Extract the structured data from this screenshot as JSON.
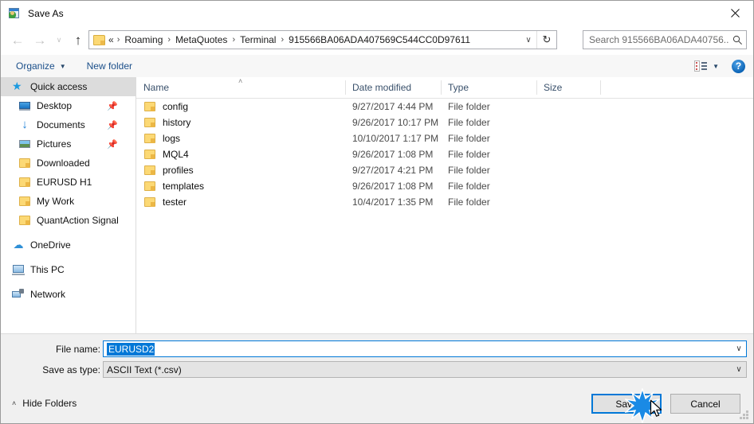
{
  "window": {
    "title": "Save As",
    "icon": "save-as-icon",
    "close_label": "✕"
  },
  "navigation": {
    "back_icon": "back-arrow-icon",
    "forward_icon": "forward-arrow-icon",
    "recent_icon": "chevron-down-icon",
    "up_icon": "up-arrow-icon",
    "back_glyph": "←",
    "forward_glyph": "→",
    "up_glyph": "↑",
    "recent_glyph": "∨"
  },
  "address": {
    "folder_icon": "folder-icon",
    "overflow": "«",
    "separator": "›",
    "crumbs": [
      "Roaming",
      "MetaQuotes",
      "Terminal",
      "915566BA06ADA407569C544CC0D97611"
    ],
    "dropdown_glyph": "∨",
    "refresh_glyph": "↻"
  },
  "search": {
    "placeholder": "Search 915566BA06ADA40756...",
    "icon": "search-icon",
    "value": ""
  },
  "toolbar": {
    "organize_label": "Organize",
    "organize_caret": "▼",
    "new_folder_label": "New folder",
    "view_icon": "view-options-icon",
    "view_caret": "▼",
    "help_icon": "help-icon",
    "help_glyph": "?"
  },
  "sidebar": {
    "items": [
      {
        "label": "Quick access",
        "icon": "star-icon",
        "level": "root",
        "selected": true,
        "pinned": false
      },
      {
        "label": "Desktop",
        "icon": "monitor-icon",
        "level": "lvl0",
        "selected": false,
        "pinned": true
      },
      {
        "label": "Documents",
        "icon": "download-icon",
        "level": "lvl0",
        "selected": false,
        "pinned": true
      },
      {
        "label": "Pictures",
        "icon": "pictures-icon",
        "level": "lvl0",
        "selected": false,
        "pinned": true
      },
      {
        "label": "Downloaded",
        "icon": "folder-icon",
        "level": "lvl0",
        "selected": false,
        "pinned": false
      },
      {
        "label": "EURUSD H1",
        "icon": "folder-icon",
        "level": "lvl0",
        "selected": false,
        "pinned": false
      },
      {
        "label": "My Work",
        "icon": "folder-icon",
        "level": "lvl0",
        "selected": false,
        "pinned": false
      },
      {
        "label": "QuantAction Signal",
        "icon": "folder-icon",
        "level": "lvl0",
        "selected": false,
        "pinned": false
      },
      {
        "label": "OneDrive",
        "icon": "cloud-icon",
        "level": "root",
        "selected": false,
        "pinned": false,
        "gap_before": true
      },
      {
        "label": "This PC",
        "icon": "pc-icon",
        "level": "root",
        "selected": false,
        "pinned": false,
        "gap_before": true
      },
      {
        "label": "Network",
        "icon": "network-icon",
        "level": "root",
        "selected": false,
        "pinned": false,
        "gap_before": true
      }
    ],
    "pin_glyph": "📌"
  },
  "file_list": {
    "columns": [
      {
        "label": "Name",
        "sorted": true,
        "sort_glyph": "˄"
      },
      {
        "label": "Date modified",
        "sorted": false,
        "sort_glyph": ""
      },
      {
        "label": "Type",
        "sorted": false,
        "sort_glyph": ""
      },
      {
        "label": "Size",
        "sorted": false,
        "sort_glyph": ""
      }
    ],
    "rows": [
      {
        "name": "config",
        "icon": "folder-icon",
        "date": "9/27/2017 4:44 PM",
        "type": "File folder",
        "size": ""
      },
      {
        "name": "history",
        "icon": "folder-icon",
        "date": "9/26/2017 10:17 PM",
        "type": "File folder",
        "size": ""
      },
      {
        "name": "logs",
        "icon": "folder-icon",
        "date": "10/10/2017 1:17 PM",
        "type": "File folder",
        "size": ""
      },
      {
        "name": "MQL4",
        "icon": "folder-icon",
        "date": "9/26/2017 1:08 PM",
        "type": "File folder",
        "size": ""
      },
      {
        "name": "profiles",
        "icon": "folder-icon",
        "date": "9/27/2017 4:21 PM",
        "type": "File folder",
        "size": ""
      },
      {
        "name": "templates",
        "icon": "folder-icon",
        "date": "9/26/2017 1:08 PM",
        "type": "File folder",
        "size": ""
      },
      {
        "name": "tester",
        "icon": "folder-icon",
        "date": "10/4/2017 1:35 PM",
        "type": "File folder",
        "size": ""
      }
    ]
  },
  "form": {
    "file_name_label": "File name:",
    "file_name_value": "EURUSD2",
    "file_name_selected": true,
    "save_type_label": "Save as type:",
    "save_type_value": "ASCII Text (*.csv)",
    "caret_glyph": "∨"
  },
  "footer": {
    "hide_folders_label": "Hide Folders",
    "hide_folders_caret": "˄",
    "save_label": "Save",
    "cancel_label": "Cancel",
    "save_focused": true,
    "resize_grip": "resize-grip"
  },
  "colors": {
    "accent": "#0078d7",
    "selection": "#0078d7",
    "sidebar_selection": "#dcdcdc",
    "link": "#1b4f8a",
    "folder": "#fcd975",
    "window_bg": "#f0f0f0",
    "pane_bg": "#ffffff"
  }
}
